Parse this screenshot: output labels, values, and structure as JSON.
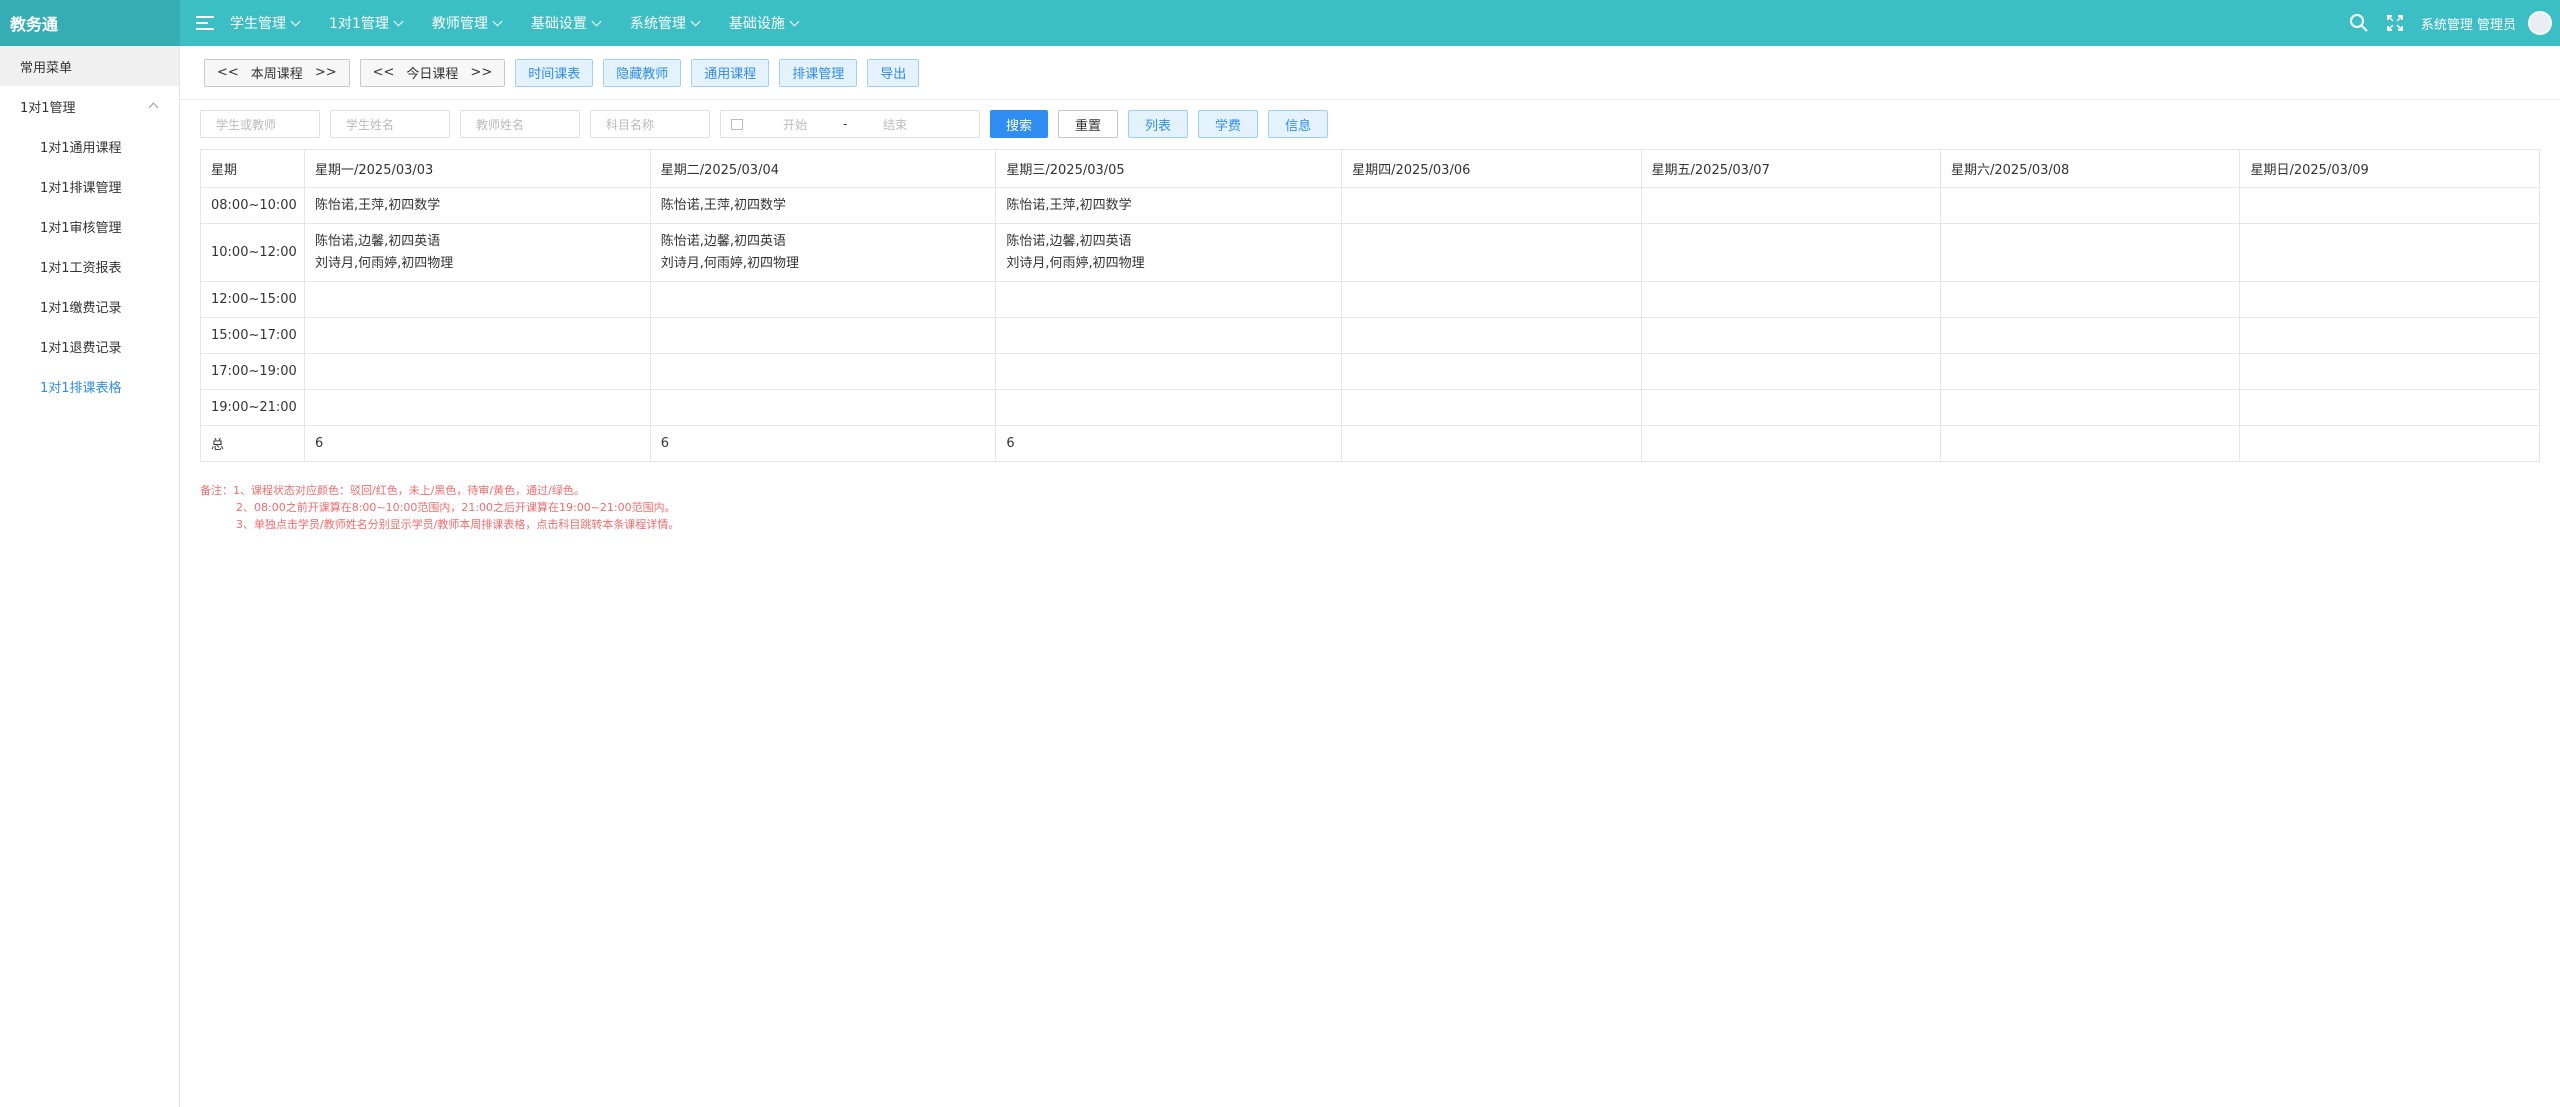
{
  "app": {
    "logo": "教务通"
  },
  "nav": [
    {
      "label": "学生管理"
    },
    {
      "label": "1对1管理"
    },
    {
      "label": "教师管理"
    },
    {
      "label": "基础设置"
    },
    {
      "label": "系统管理"
    },
    {
      "label": "基础设施"
    }
  ],
  "user": {
    "label": "系统管理 管理员"
  },
  "sidebar": {
    "favorites": "常用菜单",
    "group": "1对1管理",
    "items": [
      {
        "label": "1对1通用课程"
      },
      {
        "label": "1对1排课管理"
      },
      {
        "label": "1对1审核管理"
      },
      {
        "label": "1对1工资报表"
      },
      {
        "label": "1对1缴费记录"
      },
      {
        "label": "1对1退费记录"
      },
      {
        "label": "1对1排课表格"
      }
    ],
    "active_index": 6
  },
  "toolbar": {
    "week_btn": {
      "left": "<<",
      "label": "本周课程",
      "right": ">>"
    },
    "today_btn": {
      "left": "<<",
      "label": "今日课程",
      "right": ">>"
    },
    "buttons": [
      "时间课表",
      "隐藏教师",
      "通用课程",
      "排课管理",
      "导出"
    ]
  },
  "filters": {
    "student_or_teacher": "学生或教师",
    "student_name": "学生姓名",
    "teacher_name": "教师姓名",
    "subject_name": "科目名称",
    "date_start": "开始",
    "date_sep": "-",
    "date_end": "结束",
    "search": "搜索",
    "reset": "重置",
    "list": "列表",
    "fee": "学费",
    "info": "信息"
  },
  "table": {
    "headers": [
      "星期",
      "星期一/2025/03/03",
      "星期二/2025/03/04",
      "星期三/2025/03/05",
      "星期四/2025/03/06",
      "星期五/2025/03/07",
      "星期六/2025/03/08",
      "星期日/2025/03/09"
    ],
    "rows": [
      {
        "time": "08:00~10:00",
        "cells": [
          [
            "陈怡诺,王萍,初四数学"
          ],
          [
            "陈怡诺,王萍,初四数学"
          ],
          [
            "陈怡诺,王萍,初四数学"
          ],
          [],
          [],
          [],
          []
        ]
      },
      {
        "time": "10:00~12:00",
        "cells": [
          [
            "陈怡诺,边馨,初四英语",
            "刘诗月,何雨婷,初四物理"
          ],
          [
            "陈怡诺,边馨,初四英语",
            "刘诗月,何雨婷,初四物理"
          ],
          [
            "陈怡诺,边馨,初四英语",
            "刘诗月,何雨婷,初四物理"
          ],
          [],
          [],
          [],
          []
        ]
      },
      {
        "time": "12:00~15:00",
        "cells": [
          [],
          [],
          [],
          [],
          [],
          [],
          []
        ]
      },
      {
        "time": "15:00~17:00",
        "cells": [
          [],
          [],
          [],
          [],
          [],
          [],
          []
        ]
      },
      {
        "time": "17:00~19:00",
        "cells": [
          [],
          [],
          [],
          [],
          [],
          [],
          []
        ]
      },
      {
        "time": "19:00~21:00",
        "cells": [
          [],
          [],
          [],
          [],
          [],
          [],
          []
        ]
      }
    ],
    "total": {
      "label": "总",
      "values": [
        "6",
        "6",
        "6",
        "",
        "",
        "",
        ""
      ]
    }
  },
  "notes": [
    "备注：1、课程状态对应颜色：驳回/红色，未上/黑色，待审/黄色，通过/绿色。",
    "2、08:00之前开课算在8:00~10:00范围内，21:00之后开课算在19:00~21:00范围内。",
    "3、单独点击学员/教师姓名分别显示学员/教师本周排课表格，点击科目跳转本条课程详情。"
  ],
  "colors": {
    "topbar": "#3cbfc4",
    "logo_bg": "#36adb2",
    "primary": "#2f8cf0",
    "note": "#f56c6c"
  }
}
